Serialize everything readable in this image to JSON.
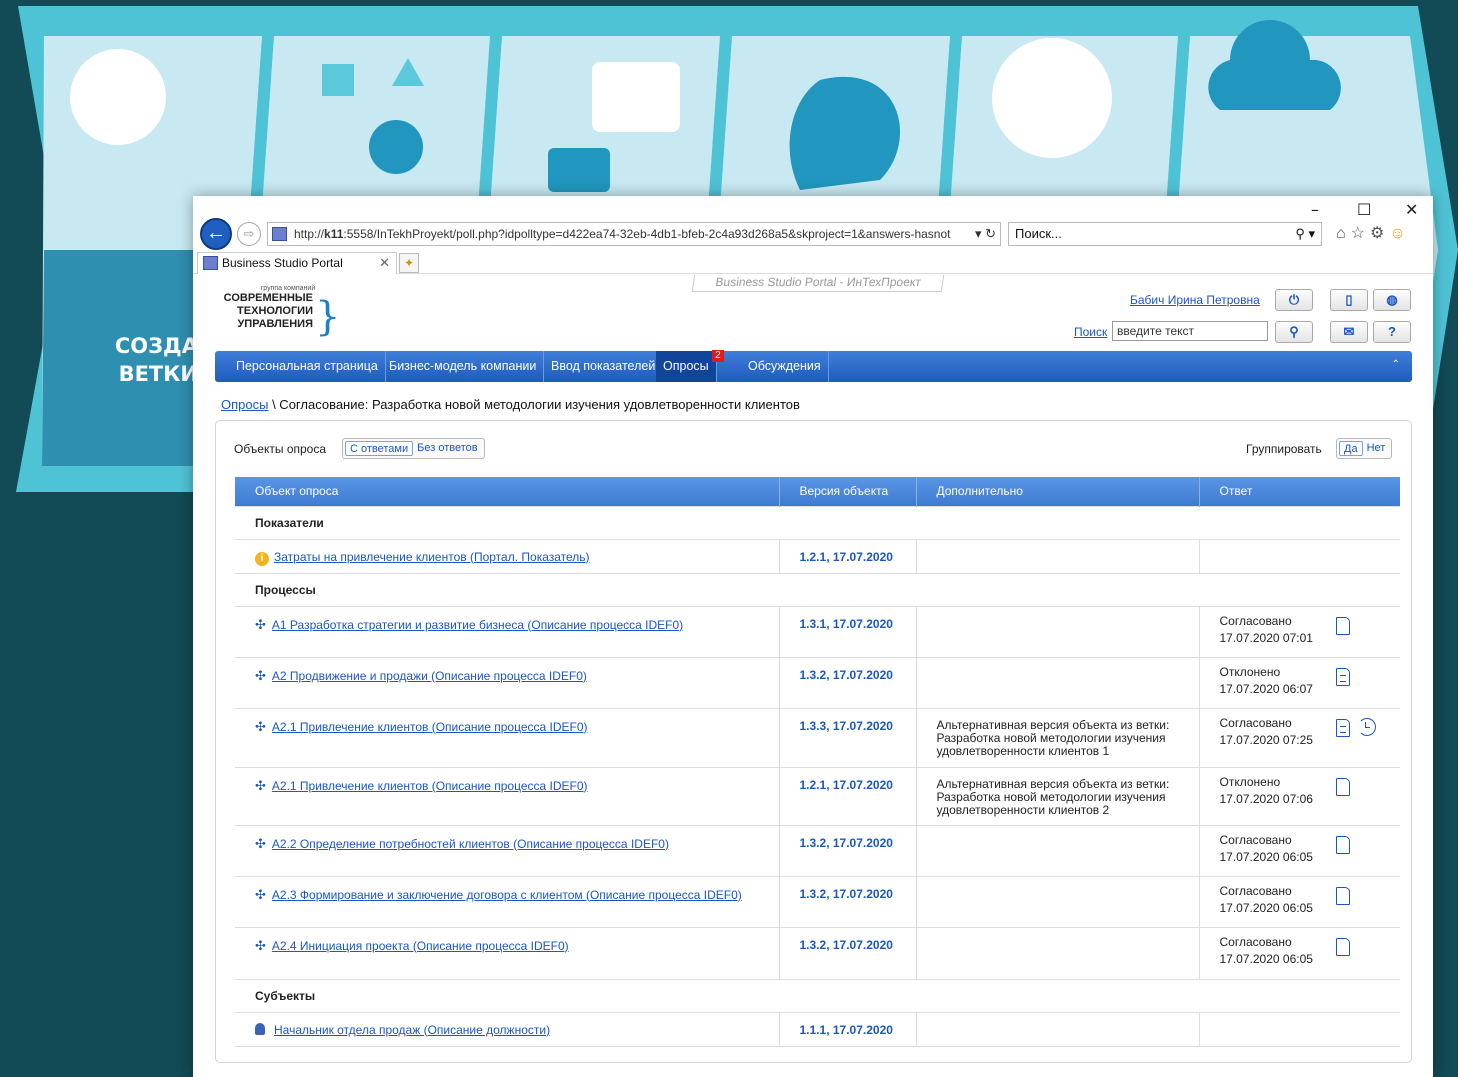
{
  "background": {
    "side_text_line1": "СОЗДА",
    "side_text_line2": "ВЕТКИ"
  },
  "browser": {
    "url_prefix": "http://",
    "url_host": "k11",
    "url_rest": ":5558/InTekhProyekt/poll.php?idpolltype=d422ea74-32eb-4db1-bfeb-2c4a93d268a5&skproject=1&answers-hasnot",
    "search_placeholder": "Поиск...",
    "tab_title": "Business Studio Portal",
    "window_controls": [
      "–",
      "☐",
      "✕"
    ],
    "toolbar_icons": [
      "home-icon",
      "favorites-icon",
      "settings-icon",
      "smiley-icon"
    ]
  },
  "portal": {
    "title": "Business Studio Portal - ИнТехПроект",
    "logo": {
      "small": "группа компаний",
      "line1": "СОВРЕМЕННЫЕ",
      "line2": "ТЕХНОЛОГИИ",
      "line3": "УПРАВЛЕНИЯ"
    },
    "user_name": "Бабич Ирина Петровна",
    "search_label": "Поиск",
    "search_value": "введите текст",
    "menu": [
      {
        "label": "Персональная страница"
      },
      {
        "label": "Бизнес-модель компании"
      },
      {
        "label": "Ввод показателей"
      },
      {
        "label": "Опросы",
        "badge": "2"
      },
      {
        "label": "Обсуждения"
      }
    ],
    "breadcrumb_link": "Опросы",
    "breadcrumb_rest": " \\ Согласование: Разработка новой методологии изучения удовлетворенности клиентов",
    "filter_label": "Объекты опроса",
    "filter_on": "С ответами",
    "filter_off": "Без ответов",
    "group_label": "Группировать",
    "group_yes": "Да",
    "group_no": "Нет",
    "columns": [
      "Объект опроса",
      "Версия объекта",
      "Дополнительно",
      "Ответ"
    ],
    "groups": {
      "indicators": "Показатели",
      "processes": "Процессы",
      "subjects": "Субъекты"
    },
    "rows": {
      "r1": {
        "object": "Затраты на привлечение клиентов (Портал. Показатель)",
        "version": "1.2.1, 17.07.2020",
        "extra": "",
        "status": "",
        "date": ""
      },
      "r2": {
        "object": "А1 Разработка стратегии и развитие бизнеса (Описание процесса IDEF0)",
        "version": "1.3.1, 17.07.2020",
        "extra": "",
        "status": "Согласовано",
        "date": "17.07.2020 07:01"
      },
      "r3": {
        "object": "А2 Продвижение и продажи (Описание процесса IDEF0)",
        "version": "1.3.2, 17.07.2020",
        "extra": "",
        "status": "Отклонено",
        "date": "17.07.2020 06:07"
      },
      "r4": {
        "object": "А2.1 Привлечение клиентов (Описание процесса IDEF0)",
        "version": "1.3.3, 17.07.2020",
        "extra": "Альтернативная версия объекта из ветки: Разработка новой методологии изучения удовлетворенности клиентов 1",
        "status": "Согласовано",
        "date": "17.07.2020 07:25"
      },
      "r5": {
        "object": "А2.1 Привлечение клиентов (Описание процесса IDEF0)",
        "version": "1.2.1, 17.07.2020",
        "extra": "Альтернативная версия объекта из ветки: Разработка новой методологии изучения удовлетворенности клиентов 2",
        "status": "Отклонено",
        "date": "17.07.2020 07:06"
      },
      "r6": {
        "object": "А2.2 Определение потребностей клиентов (Описание процесса IDEF0)",
        "version": "1.3.2, 17.07.2020",
        "extra": "",
        "status": "Согласовано",
        "date": "17.07.2020 06:05"
      },
      "r7": {
        "object": "А2.3 Формирование и заключение договора с клиентом (Описание процесса IDEF0)",
        "version": "1.3.2, 17.07.2020",
        "extra": "",
        "status": "Согласовано",
        "date": "17.07.2020 06:05"
      },
      "r8": {
        "object": "А2.4 Инициация проекта (Описание процесса IDEF0)",
        "version": "1.3.2, 17.07.2020",
        "extra": "",
        "status": "Согласовано",
        "date": "17.07.2020 06:05"
      },
      "r9": {
        "object": "Начальник отдела продаж (Описание должности)",
        "version": "1.1.1, 17.07.2020",
        "extra": "",
        "status": "",
        "date": ""
      }
    }
  }
}
